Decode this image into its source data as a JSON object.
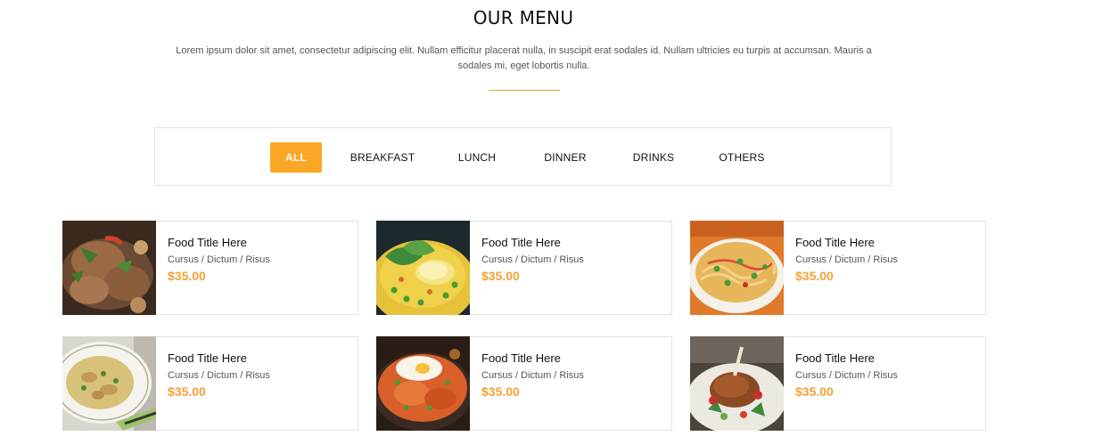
{
  "header": {
    "title": "OUR MENU",
    "description": "Lorem ipsum dolor sit amet, consectetur adipiscing elit. Nullam efficitur placerat nulla, in suscipit erat sodales id. Nullam ultricies eu turpis at accumsan. Mauris a sodales mi, eget lobortis nulla."
  },
  "filters": [
    {
      "label": "ALL",
      "active": true
    },
    {
      "label": "BREAKFAST"
    },
    {
      "label": "LUNCH"
    },
    {
      "label": "DINNER"
    },
    {
      "label": "DRINKS"
    },
    {
      "label": "OTHERS"
    }
  ],
  "colors": {
    "accent": "#fba624",
    "price": "#f7a035",
    "divider": "#e0a83a"
  },
  "items": [
    {
      "title": "Food Title Here",
      "subtitle": "Cursus / Dictum / Risus",
      "price": "$35.00",
      "image": "roast-chicken-plate"
    },
    {
      "title": "Food Title Here",
      "subtitle": "Cursus / Dictum / Risus",
      "price": "$35.00",
      "image": "rice-with-peas-and-lemon"
    },
    {
      "title": "Food Title Here",
      "subtitle": "Cursus / Dictum / Risus",
      "price": "$35.00",
      "image": "noodle-bowl"
    },
    {
      "title": "Food Title Here",
      "subtitle": "Cursus / Dictum / Risus",
      "price": "$35.00",
      "image": "soup-bowl"
    },
    {
      "title": "Food Title Here",
      "subtitle": "Cursus / Dictum / Risus",
      "price": "$35.00",
      "image": "paella-with-egg"
    },
    {
      "title": "Food Title Here",
      "subtitle": "Cursus / Dictum / Risus",
      "price": "$35.00",
      "image": "roast-duck-leg"
    }
  ]
}
